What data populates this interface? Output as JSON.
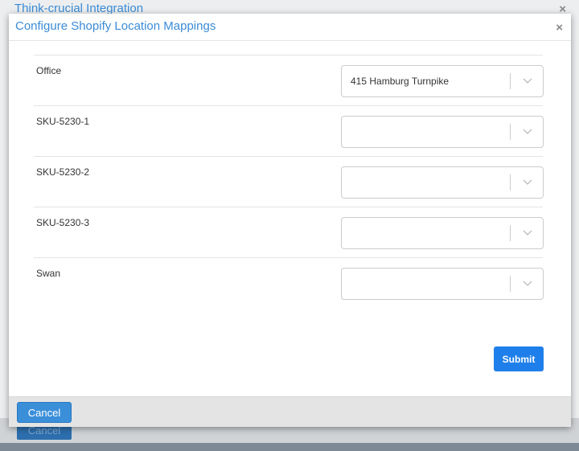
{
  "background_dialog": {
    "title": "Think-crucial Integration",
    "close_glyph": "×",
    "cancel_label": "Cancel"
  },
  "modal": {
    "title": "Configure Shopify Location Mappings",
    "close_glyph": "×",
    "rows": [
      {
        "label": "Office",
        "selected": "415 Hamburg Turnpike"
      },
      {
        "label": "SKU-5230-1",
        "selected": ""
      },
      {
        "label": "SKU-5230-2",
        "selected": ""
      },
      {
        "label": "SKU-5230-3",
        "selected": ""
      },
      {
        "label": "Swan",
        "selected": ""
      }
    ],
    "submit_label": "Submit",
    "cancel_label": "Cancel"
  },
  "colors": {
    "title": "#3a8bd6",
    "submit": "#1f7fea",
    "cancel": "#3b8fd9"
  },
  "icons": {
    "close": "close-icon",
    "dropdown": "chevron-down-icon"
  }
}
